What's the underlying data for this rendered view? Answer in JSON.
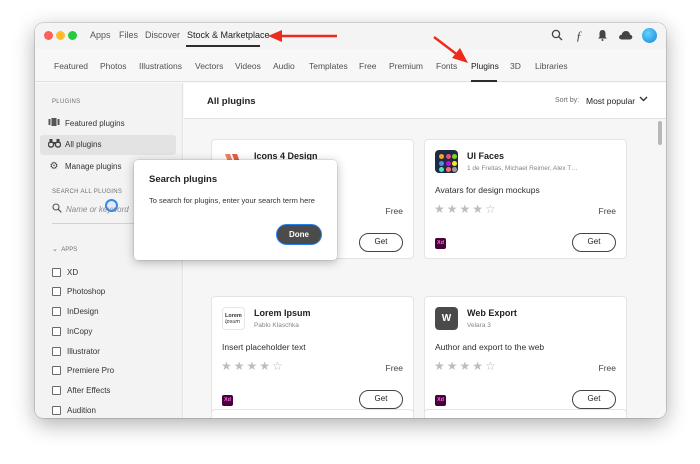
{
  "colors": {
    "annotation_arrow": "#ec2b1e",
    "accent_focus": "#2680eb",
    "xd_badge": "#470137"
  },
  "titlebar": {
    "nav": [
      "Apps",
      "Files",
      "Discover",
      "Stock & Marketplace"
    ],
    "icons": [
      "search-icon",
      "fonts-icon",
      "notification-bell-icon",
      "cloud-icon",
      "avatar"
    ]
  },
  "categories": [
    "Featured",
    "Photos",
    "Illustrations",
    "Vectors",
    "Videos",
    "Audio",
    "Templates",
    "Free",
    "Premium",
    "Fonts",
    "Plugins",
    "3D",
    "Libraries"
  ],
  "sidebar": {
    "plugins_heading": "PLUGINS",
    "items": [
      {
        "label": "Featured plugins",
        "icon": "featured-icon"
      },
      {
        "label": "All plugins",
        "icon": "binoculars-icon"
      },
      {
        "label": "Manage plugins",
        "icon": "gear-icon"
      }
    ],
    "search_heading": "SEARCH ALL PLUGINS",
    "search_placeholder": "Name or keyword",
    "apps_heading": "APPS",
    "apps": [
      "XD",
      "Photoshop",
      "InDesign",
      "InCopy",
      "Illustrator",
      "Premiere Pro",
      "After Effects",
      "Audition"
    ]
  },
  "main": {
    "title": "All plugins",
    "sort_label": "Sort by:",
    "sort_value": "Most popular",
    "cards": [
      {
        "name": "Icons 4 Design",
        "author": "",
        "description": "s",
        "price": "Free",
        "rating": 0,
        "app_badge": "Xd",
        "button": "Get"
      },
      {
        "name": "UI Faces",
        "author": "1 de Freitas, Michael Reimer, Alex T…",
        "description": "Avatars for design mockups",
        "price": "Free",
        "rating": 0,
        "app_badge": "Xd",
        "button": "Get"
      },
      {
        "name": "Lorem Ipsum",
        "author": "Pablo Klaschka",
        "description": "Insert placeholder text",
        "price": "Free",
        "rating": 0,
        "app_badge": "Xd",
        "button": "Get",
        "thumb_text": [
          "Lorem",
          "Ipsum"
        ]
      },
      {
        "name": "Web Export",
        "author": "Velara 3",
        "description": "Author and export to the web",
        "price": "Free",
        "rating": 0,
        "app_badge": "Xd",
        "button": "Get",
        "thumb_text": [
          "W"
        ]
      }
    ]
  },
  "popover": {
    "title": "Search plugins",
    "body": "To search for plugins, enter your search term here",
    "button": "Done"
  }
}
